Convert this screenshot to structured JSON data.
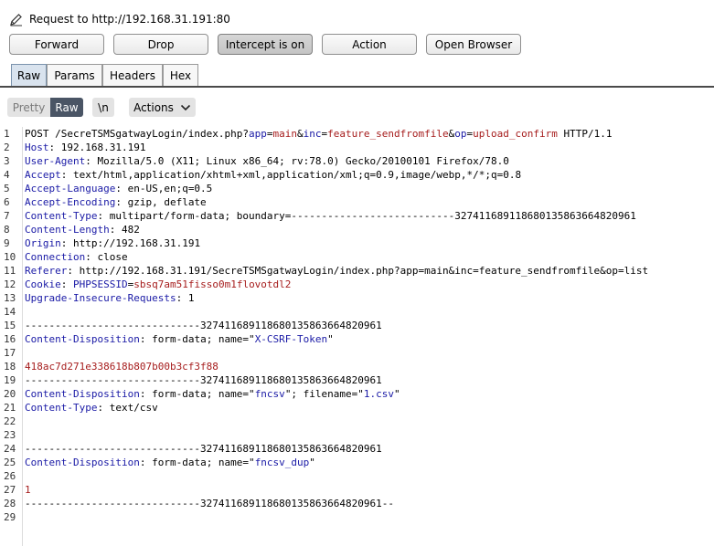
{
  "request_title": "Request to http://192.168.31.191:80",
  "buttons": {
    "forward": "Forward",
    "drop": "Drop",
    "intercept": "Intercept is on",
    "action": "Action",
    "open_browser": "Open Browser"
  },
  "tabs": {
    "raw": "Raw",
    "params": "Params",
    "headers": "Headers",
    "hex": "Hex"
  },
  "toolbar": {
    "pretty": "Pretty",
    "raw": "Raw",
    "newline": "\\n",
    "actions": "Actions"
  },
  "lines": [
    {
      "n": "1",
      "parts": [
        [
          "POST /SecreTSMSgatwayLogin/index.php?",
          ""
        ],
        [
          "app",
          "k"
        ],
        [
          "=",
          ""
        ],
        [
          "main",
          "v"
        ],
        [
          "&",
          ""
        ],
        [
          "inc",
          "k"
        ],
        [
          "=",
          ""
        ],
        [
          "feature_sendfromfile",
          "v"
        ],
        [
          "&",
          ""
        ],
        [
          "op",
          "k"
        ],
        [
          "=",
          ""
        ],
        [
          "upload_confirm",
          "v"
        ],
        [
          " HTTP/1.1",
          ""
        ]
      ]
    },
    {
      "n": "2",
      "parts": [
        [
          "Host",
          "k"
        ],
        [
          ": 192.168.31.191",
          ""
        ]
      ]
    },
    {
      "n": "3",
      "parts": [
        [
          "User-Agent",
          "k"
        ],
        [
          ": Mozilla/5.0 (X11; Linux x86_64; rv:78.0) Gecko/20100101 Firefox/78.0",
          ""
        ]
      ]
    },
    {
      "n": "4",
      "parts": [
        [
          "Accept",
          "k"
        ],
        [
          ": text/html,application/xhtml+xml,application/xml;q=0.9,image/webp,*/*;q=0.8",
          ""
        ]
      ]
    },
    {
      "n": "5",
      "parts": [
        [
          "Accept-Language",
          "k"
        ],
        [
          ": en-US,en;q=0.5",
          ""
        ]
      ]
    },
    {
      "n": "6",
      "parts": [
        [
          "Accept-Encoding",
          "k"
        ],
        [
          ": gzip, deflate",
          ""
        ]
      ]
    },
    {
      "n": "7",
      "parts": [
        [
          "Content-Type",
          "k"
        ],
        [
          ": multipart/form-data; boundary=---------------------------327411689118680135863664820961",
          ""
        ]
      ]
    },
    {
      "n": "8",
      "parts": [
        [
          "Content-Length",
          "k"
        ],
        [
          ": 482",
          ""
        ]
      ]
    },
    {
      "n": "9",
      "parts": [
        [
          "Origin",
          "k"
        ],
        [
          ": http://192.168.31.191",
          ""
        ]
      ]
    },
    {
      "n": "10",
      "parts": [
        [
          "Connection",
          "k"
        ],
        [
          ": close",
          ""
        ]
      ]
    },
    {
      "n": "11",
      "parts": [
        [
          "Referer",
          "k"
        ],
        [
          ": http://192.168.31.191/SecreTSMSgatwayLogin/index.php?app=main&inc=feature_sendfromfile&op=list",
          ""
        ]
      ]
    },
    {
      "n": "12",
      "parts": [
        [
          "Cookie",
          "k"
        ],
        [
          ": ",
          ""
        ],
        [
          "PHPSESSID",
          "k"
        ],
        [
          "=",
          ""
        ],
        [
          "sbsq7am51fisso0m1flovotdl2",
          "v"
        ]
      ]
    },
    {
      "n": "13",
      "parts": [
        [
          "Upgrade-Insecure-Requests",
          "k"
        ],
        [
          ": 1",
          ""
        ]
      ]
    },
    {
      "n": "14",
      "parts": []
    },
    {
      "n": "15",
      "parts": [
        [
          "-----------------------------327411689118680135863664820961",
          ""
        ]
      ]
    },
    {
      "n": "16",
      "parts": [
        [
          "Content-Disposition",
          "k"
        ],
        [
          ": form-data; name=\"",
          ""
        ],
        [
          "X-CSRF-Token",
          "s"
        ],
        [
          "\"",
          ""
        ]
      ]
    },
    {
      "n": "17",
      "parts": []
    },
    {
      "n": "18",
      "parts": [
        [
          "418ac7d271e338618b807b00b3cf3f88",
          "v"
        ]
      ]
    },
    {
      "n": "19",
      "parts": [
        [
          "-----------------------------327411689118680135863664820961",
          ""
        ]
      ]
    },
    {
      "n": "20",
      "parts": [
        [
          "Content-Disposition",
          "k"
        ],
        [
          ": form-data; name=\"",
          ""
        ],
        [
          "fncsv",
          "s"
        ],
        [
          "\"; filename=\"",
          ""
        ],
        [
          "1.csv",
          "s"
        ],
        [
          "\"",
          ""
        ]
      ]
    },
    {
      "n": "21",
      "parts": [
        [
          "Content-Type",
          "k"
        ],
        [
          ": text/csv",
          ""
        ]
      ]
    },
    {
      "n": "22",
      "parts": []
    },
    {
      "n": "23",
      "parts": []
    },
    {
      "n": "24",
      "parts": [
        [
          "-----------------------------327411689118680135863664820961",
          ""
        ]
      ]
    },
    {
      "n": "25",
      "parts": [
        [
          "Content-Disposition",
          "k"
        ],
        [
          ": form-data; name=\"",
          ""
        ],
        [
          "fncsv_dup",
          "s"
        ],
        [
          "\"",
          ""
        ]
      ]
    },
    {
      "n": "26",
      "parts": []
    },
    {
      "n": "27",
      "parts": [
        [
          "1",
          "v"
        ]
      ]
    },
    {
      "n": "28",
      "parts": [
        [
          "-----------------------------327411689118680135863664820961--",
          ""
        ]
      ]
    },
    {
      "n": "29",
      "parts": []
    }
  ]
}
